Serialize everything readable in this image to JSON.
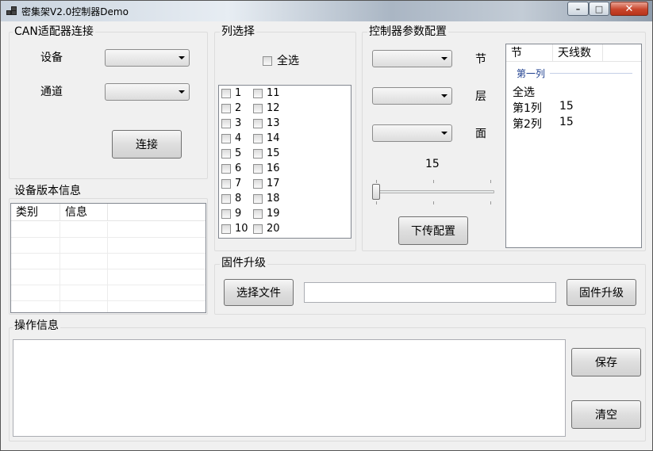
{
  "window": {
    "title": "密集架V2.0控制器Demo",
    "buttons": {
      "minimize": "–",
      "maximize": "□",
      "close": "✕"
    }
  },
  "can_group": {
    "title": "CAN适配器连接",
    "device_label": "设备",
    "device_value": "",
    "channel_label": "通道",
    "channel_value": "",
    "connect_button": "连接"
  },
  "column_group": {
    "title": "列选择",
    "select_all": "全选",
    "items_left": [
      "1",
      "2",
      "3",
      "4",
      "5",
      "6",
      "7",
      "8",
      "9",
      "10"
    ],
    "items_right": [
      "11",
      "12",
      "13",
      "14",
      "15",
      "16",
      "17",
      "18",
      "19",
      "20"
    ]
  },
  "controller_group": {
    "title": "控制器参数配置",
    "section_label": "节",
    "layer_label": "层",
    "face_label": "面",
    "section_value": "",
    "layer_value": "",
    "face_value": "",
    "slider_value": "15",
    "slider_fraction": 0.0,
    "download_button": "下传配置",
    "list": {
      "headers": [
        "节",
        "天线数"
      ],
      "group_header": "第一列",
      "rows": [
        {
          "name": "全选",
          "value": ""
        },
        {
          "name": "第1列",
          "value": "15"
        },
        {
          "name": "第2列",
          "value": "15"
        }
      ]
    }
  },
  "version_group": {
    "title": "设备版本信息",
    "headers": [
      "类别",
      "信息"
    ]
  },
  "firmware_group": {
    "title": "固件升级",
    "select_file_button": "选择文件",
    "file_path": "",
    "upgrade_button": "固件升级"
  },
  "ops_group": {
    "title": "操作信息",
    "log": "",
    "save_button": "保存",
    "clear_button": "清空"
  }
}
